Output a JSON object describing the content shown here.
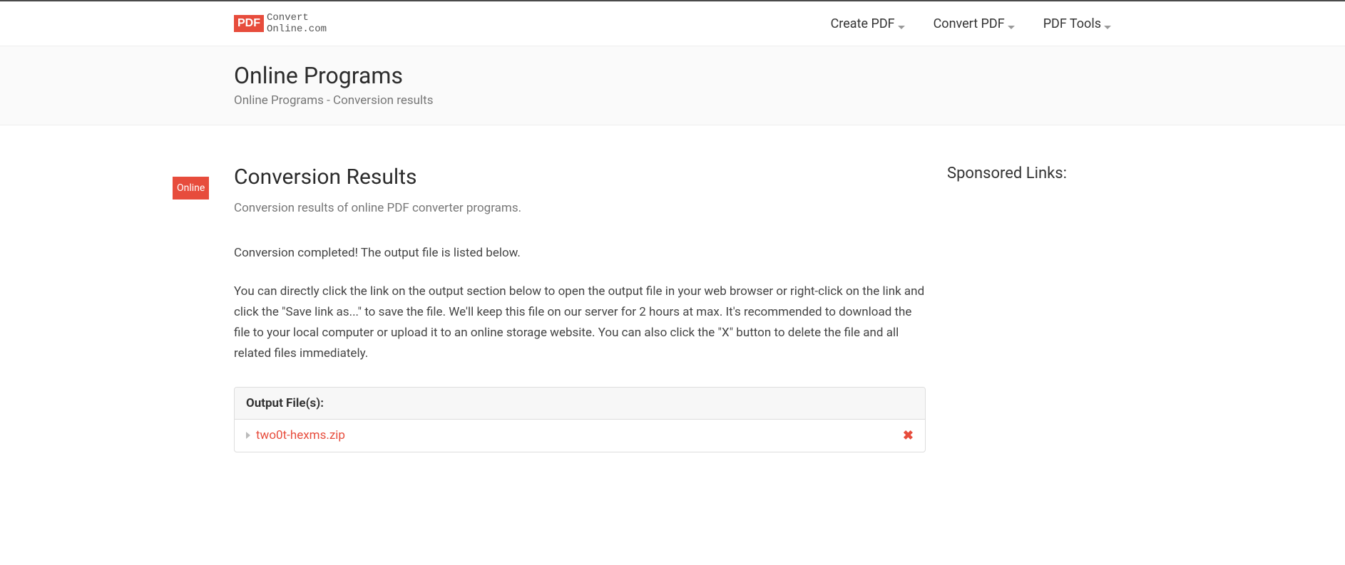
{
  "logo": {
    "badge": "PDF",
    "line1": "Convert",
    "line2": "Online.com"
  },
  "nav": {
    "items": [
      {
        "label": "Create PDF"
      },
      {
        "label": "Convert PDF"
      },
      {
        "label": "PDF Tools"
      }
    ]
  },
  "page_header": {
    "title": "Online Programs",
    "subtitle": "Online Programs - Conversion results"
  },
  "online_badge": "Online",
  "main": {
    "heading": "Conversion Results",
    "subtext": "Conversion results of online PDF converter programs.",
    "completion": "Conversion completed! The output file is listed below.",
    "instruction": "You can directly click the link on the output section below to open the output file in your web browser or right-click on the link and click the \"Save link as...\" to save the file. We'll keep this file on our server for 2 hours at max. It's recommended to download the file to your local computer or upload it to an online storage website. You can also click the \"X\" button to delete the file and all related files immediately."
  },
  "output": {
    "header": "Output File(s):",
    "files": [
      {
        "name": "two0t-hexms.zip"
      }
    ]
  },
  "sidebar": {
    "sponsored_heading": "Sponsored Links:"
  }
}
